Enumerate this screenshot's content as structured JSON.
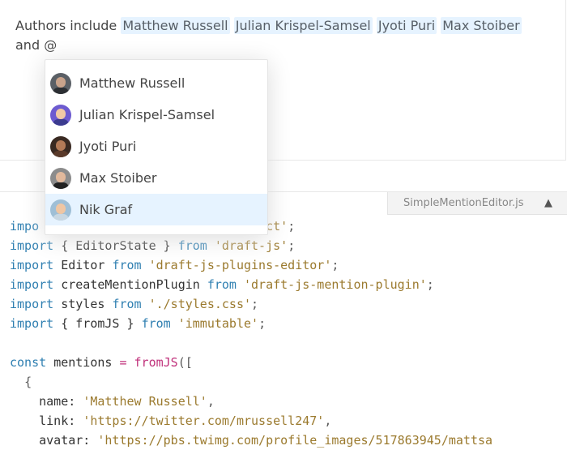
{
  "editor": {
    "prefix": "Authors include",
    "mentions": [
      "Matthew Russell",
      "Julian Krispel-Samsel",
      "Jyoti Puri",
      "Max Stoiber"
    ],
    "trailing": "and @"
  },
  "suggestions": [
    {
      "name": "Matthew Russell",
      "avatar_bg": "#5b6066",
      "skin": "#c9a38b",
      "cloth": "#2c2f33"
    },
    {
      "name": "Julian Krispel-Samsel",
      "avatar_bg": "#6d5bd0",
      "skin": "#f1c9a5",
      "cloth": "#3b3b8f"
    },
    {
      "name": "Jyoti Puri",
      "avatar_bg": "#3a2a22",
      "skin": "#b37a57",
      "cloth": "#5a3a2a"
    },
    {
      "name": "Max Stoiber",
      "avatar_bg": "#8c8c8c",
      "skin": "#e2b99c",
      "cloth": "#222222"
    },
    {
      "name": "Nik Graf",
      "avatar_bg": "#9fbfd6",
      "skin": "#efc6a3",
      "cloth": "#c8d7e2"
    }
  ],
  "focused_suggestion": "Nik Graf",
  "file_tab": {
    "label": "SimpleMentionEditor.js",
    "arrow": "▲"
  },
  "code": {
    "l1": {
      "a": "impo",
      "b": "m",
      "c": "'react'",
      "d": ";"
    },
    "l2": {
      "a": "import",
      "b": "{ EditorState }",
      "c": "from",
      "d": "'draft-js'",
      "e": ";"
    },
    "l3": {
      "a": "import",
      "b": "Editor",
      "c": "from",
      "d": "'draft-js-plugins-editor'",
      "e": ";"
    },
    "l4": {
      "a": "import",
      "b": "createMentionPlugin",
      "c": "from",
      "d": "'draft-js-mention-plugin'",
      "e": ";"
    },
    "l5": {
      "a": "import",
      "b": "styles",
      "c": "from",
      "d": "'./styles.css'",
      "e": ";"
    },
    "l6": {
      "a": "import",
      "b": "{ fromJS }",
      "c": "from",
      "d": "'immutable'",
      "e": ";"
    },
    "l8": {
      "a": "const",
      "b": "mentions",
      "c": "=",
      "d": "fromJS",
      "e": "(["
    },
    "l9": {
      "a": "{"
    },
    "l10": {
      "a": "name:",
      "b": "'Matthew Russell'",
      "c": ","
    },
    "l11": {
      "a": "link:",
      "b": "'https://twitter.com/mrussell247'",
      "c": ","
    },
    "l12": {
      "a": "avatar:",
      "b": "'https://pbs.twimg.com/profile_images/517863945/mattsa"
    }
  }
}
